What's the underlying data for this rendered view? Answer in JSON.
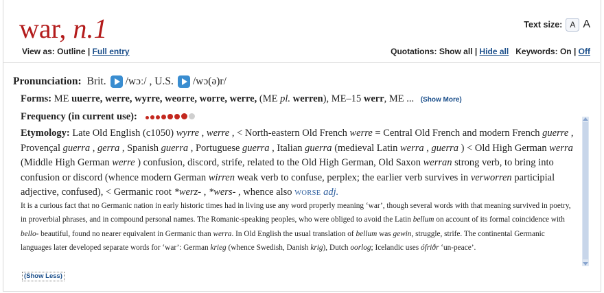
{
  "headword": {
    "word": "war,",
    "pos": "n.",
    "hom": "1"
  },
  "text_size": {
    "label": "Text size:",
    "small": "A",
    "large": "A"
  },
  "view_as": {
    "label": "View as:",
    "current": "Outline",
    "sep": "|",
    "link": "Full entry"
  },
  "quotations": {
    "label": "Quotations:",
    "show_all": "Show all",
    "sep": "|",
    "hide_all": "Hide all",
    "keywords_label": "Keywords:",
    "on": "On",
    "sep2": "|",
    "off": "Off"
  },
  "pronunciation": {
    "label": "Pronunciation:",
    "brit_label": "Brit.",
    "brit_ipa": "/wɔː/ ,",
    "us_label": "U.S.",
    "us_ipa": "/wɔ(ə)r/"
  },
  "forms": {
    "label": "Forms:",
    "seg1": "ME ",
    "bold1": "uuerre, werre, wyrre, weorre, worre, werre,",
    "seg2": " (ME ",
    "ital1": "pl.",
    "seg3": " ",
    "bold2": "werren",
    "seg4": "), ME–15 ",
    "bold3": "werr",
    "seg5": ", ME  ...",
    "show_more": "(Show More)"
  },
  "frequency": {
    "label": "Frequency (in current use):",
    "level": 7,
    "max": 8
  },
  "etymology": {
    "label": "Etymology:",
    "p1": " Late Old English (c1050) ",
    "i1": "wyrre",
    "p2": " , ",
    "i2": "werre",
    "p3": " , < North-eastern Old French ",
    "i3": "werre",
    "p4": " = Central Old French and modern French ",
    "i4": "guerre",
    "p5": " , Provençal ",
    "i5": "guerra",
    "p6": " , ",
    "i6": "gerra",
    "p7": " , Spanish ",
    "i7": "guerra",
    "p8": " , Portuguese ",
    "i8": "guerra",
    "p9": " , Italian ",
    "i9": "guerra",
    "p10": " (medieval Latin ",
    "i10": "werra",
    "p11": " , ",
    "i11": "guerra",
    "p12": " ) < Old High German ",
    "i12": "werra",
    "p13": " (Middle High German ",
    "i13": "werre",
    "p14": " ) confusion, discord, strife, related to the Old High German, Old Saxon ",
    "i14": "werran",
    "p15": " strong verb, to bring into confusion or discord (whence modern German ",
    "i15": "wirren",
    "p16": " weak verb to confuse, perplex; the earlier verb survives in ",
    "i16": "verworren",
    "p17": " participial adjective, confused), < Germanic root ",
    "i17": "*werz-",
    "p18": " , ",
    "i18": "*wers-",
    "p19": " , whence also ",
    "worse": "WORSE",
    "adj": "adj."
  },
  "note": {
    "n1": "It is a curious fact that no Germanic nation in early historic times had in living use any word properly meaning ‘war’, though several words with that meaning survived in poetry, in proverbial phrases, and in compound personal names. The Romanic-speaking peoples, who were obliged to avoid the Latin ",
    "ni1": "bellum",
    "n2": " on account of its formal coincidence with ",
    "ni2": "bello-",
    "n3": " beautiful, found no nearer equivalent in Germanic than ",
    "ni3": "werra",
    "n4": ". In Old English the usual translation of ",
    "ni4": "bellum",
    "n5": " was ",
    "ni5": "gewin",
    "n6": ", struggle, strife. The continental Germanic languages later developed separate words for ‘war’: German ",
    "ni6": "krieg",
    "n7": " (whence Swedish, Danish ",
    "ni7": "krig",
    "n8": "), Dutch ",
    "ni8": "oorlog",
    "n9": "; Icelandic uses ",
    "ni9": "ófriðr",
    "n10": " ‘un-peace’."
  },
  "show_less": "(Show Less)",
  "colors": {
    "headword": "#b31b1b",
    "link": "#1a4e8a",
    "freq_on": "#c3281f",
    "freq_off": "#cfcfcf"
  }
}
